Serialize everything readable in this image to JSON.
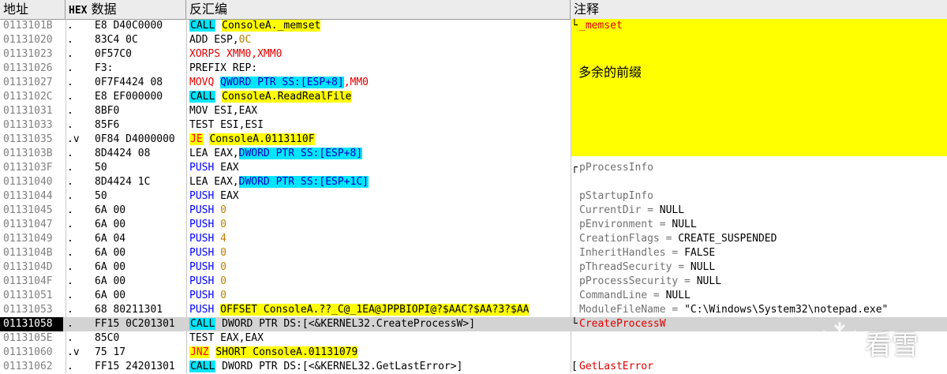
{
  "headers": {
    "address": "地址",
    "hex_prefix": "HEX",
    "hex_suffix": "数据",
    "disasm": "反汇编",
    "comment": "注释"
  },
  "note": "多余的前缀",
  "watermark": "看雪",
  "rows": [
    {
      "addr": "0113101B",
      "mark": ".",
      "hex": "E8 D40C0000",
      "dis": [
        [
          "CALL",
          "kw-call"
        ],
        [
          " ",
          ""
        ],
        [
          "ConsoleA._memset",
          "arg-y"
        ]
      ],
      "com": [
        [
          "_memset",
          "fn"
        ]
      ],
      "bk": "L"
    },
    {
      "addr": "01131020",
      "mark": ".",
      "hex": "83C4 0C",
      "dis": [
        [
          "ADD ESP,",
          ""
        ],
        [
          "0C",
          "lit"
        ]
      ],
      "com": []
    },
    {
      "addr": "01131023",
      "mark": ".",
      "hex": "0F57C0",
      "dis": [
        [
          "XORPS XMM0,XMM0",
          "kw-red"
        ]
      ],
      "com": []
    },
    {
      "addr": "01131026",
      "mark": ".",
      "hex": "F3:",
      "dis": [
        [
          "PREFIX REP:",
          ""
        ]
      ],
      "com": []
    },
    {
      "addr": "01131027",
      "mark": ".",
      "hex": "0F7F4424 08",
      "dis": [
        [
          "MOVQ",
          "kw-red"
        ],
        [
          " ",
          ""
        ],
        [
          "QWORD PTR SS:[ESP+8]",
          "arg-mem"
        ],
        [
          ",MM0",
          "kw-red"
        ]
      ],
      "com": []
    },
    {
      "addr": "0113102C",
      "mark": ".",
      "hex": "E8 EF000000",
      "dis": [
        [
          "CALL",
          "kw-call"
        ],
        [
          " ",
          ""
        ],
        [
          "ConsoleA.ReadRealFile",
          "arg-y"
        ]
      ],
      "com": []
    },
    {
      "addr": "01131031",
      "mark": ".",
      "hex": "8BF0",
      "dis": [
        [
          "MOV ESI,EAX",
          ""
        ]
      ],
      "com": []
    },
    {
      "addr": "01131033",
      "mark": ".",
      "hex": "85F6",
      "dis": [
        [
          "TEST ESI,ESI",
          ""
        ]
      ],
      "com": []
    },
    {
      "addr": "01131035",
      "mark": ".v",
      "hex": "0F84 D4000000",
      "dis": [
        [
          "JE",
          "kw-jcc"
        ],
        [
          " ",
          ""
        ],
        [
          "ConsoleA.0113110F",
          "arg-y"
        ]
      ],
      "com": []
    },
    {
      "addr": "0113103B",
      "mark": ".",
      "hex": "8D4424 08",
      "dis": [
        [
          "LEA EAX,",
          ""
        ],
        [
          "DWORD PTR SS:[ESP+8]",
          "arg-mem"
        ]
      ],
      "com": []
    },
    {
      "addr": "0113103F",
      "mark": ".",
      "hex": "50",
      "dis": [
        [
          "PUSH",
          "kw-push"
        ],
        [
          " EAX",
          ""
        ]
      ],
      "com": [
        [
          "pProcessInfo",
          "gray"
        ]
      ],
      "bk": "r"
    },
    {
      "addr": "01131040",
      "mark": ".",
      "hex": "8D4424 1C",
      "dis": [
        [
          "LEA EAX,",
          ""
        ],
        [
          "DWORD PTR SS:[ESP+1C]",
          "arg-mem"
        ]
      ],
      "com": []
    },
    {
      "addr": "01131044",
      "mark": ".",
      "hex": "50",
      "dis": [
        [
          "PUSH",
          "kw-push"
        ],
        [
          " EAX",
          ""
        ]
      ],
      "com": [
        [
          "pStartupInfo",
          "gray"
        ]
      ]
    },
    {
      "addr": "01131045",
      "mark": ".",
      "hex": "6A 00",
      "dis": [
        [
          "PUSH",
          "kw-push"
        ],
        [
          " ",
          ""
        ],
        [
          "0",
          "lit"
        ]
      ],
      "com": [
        [
          "CurrentDir = ",
          "gray"
        ],
        [
          "NULL",
          ""
        ]
      ]
    },
    {
      "addr": "01131047",
      "mark": ".",
      "hex": "6A 00",
      "dis": [
        [
          "PUSH",
          "kw-push"
        ],
        [
          " ",
          ""
        ],
        [
          "0",
          "lit"
        ]
      ],
      "com": [
        [
          "pEnvironment = ",
          "gray"
        ],
        [
          "NULL",
          ""
        ]
      ]
    },
    {
      "addr": "01131049",
      "mark": ".",
      "hex": "6A 04",
      "dis": [
        [
          "PUSH",
          "kw-push"
        ],
        [
          " ",
          ""
        ],
        [
          "4",
          "lit"
        ]
      ],
      "com": [
        [
          "CreationFlags = ",
          "gray"
        ],
        [
          "CREATE_SUSPENDED",
          ""
        ]
      ]
    },
    {
      "addr": "0113104B",
      "mark": ".",
      "hex": "6A 00",
      "dis": [
        [
          "PUSH",
          "kw-push"
        ],
        [
          " ",
          ""
        ],
        [
          "0",
          "lit"
        ]
      ],
      "com": [
        [
          "InheritHandles = ",
          "gray"
        ],
        [
          "FALSE",
          ""
        ]
      ]
    },
    {
      "addr": "0113104D",
      "mark": ".",
      "hex": "6A 00",
      "dis": [
        [
          "PUSH",
          "kw-push"
        ],
        [
          " ",
          ""
        ],
        [
          "0",
          "lit"
        ]
      ],
      "com": [
        [
          "pThreadSecurity = ",
          "gray"
        ],
        [
          "NULL",
          ""
        ]
      ]
    },
    {
      "addr": "0113104F",
      "mark": ".",
      "hex": "6A 00",
      "dis": [
        [
          "PUSH",
          "kw-push"
        ],
        [
          " ",
          ""
        ],
        [
          "0",
          "lit"
        ]
      ],
      "com": [
        [
          "pProcessSecurity = ",
          "gray"
        ],
        [
          "NULL",
          ""
        ]
      ]
    },
    {
      "addr": "01131051",
      "mark": ".",
      "hex": "6A 00",
      "dis": [
        [
          "PUSH",
          "kw-push"
        ],
        [
          " ",
          ""
        ],
        [
          "0",
          "lit"
        ]
      ],
      "com": [
        [
          "CommandLine = ",
          "gray"
        ],
        [
          "NULL",
          ""
        ]
      ]
    },
    {
      "addr": "01131053",
      "mark": ".",
      "hex": "68 80211301",
      "dis": [
        [
          "PUSH",
          "kw-push"
        ],
        [
          " ",
          ""
        ],
        [
          "OFFSET ConsoleA.??_C@_1EA@JPPBIOPI@?$AAC?$AA?3?$AA",
          "arg-y"
        ]
      ],
      "com": [
        [
          "ModuleFileName = ",
          "gray"
        ],
        [
          "\"C:\\Windows\\System32\\notepad.exe\"",
          ""
        ]
      ]
    },
    {
      "addr": "01131058",
      "mark": ".",
      "hex": "FF15 0C201301",
      "dis": [
        [
          "CALL",
          "kw-call"
        ],
        [
          " DWORD PTR DS:[<&KERNEL32.CreateProcessW>]",
          ""
        ]
      ],
      "com": [
        [
          "CreateProcessW",
          "fn"
        ]
      ],
      "sel": true,
      "bk": "L"
    },
    {
      "addr": "0113105E",
      "mark": ".",
      "hex": "85C0",
      "dis": [
        [
          "TEST EAX,EAX",
          ""
        ]
      ],
      "com": []
    },
    {
      "addr": "01131060",
      "mark": ".v",
      "hex": "75 17",
      "dis": [
        [
          "JNZ",
          "kw-jcc"
        ],
        [
          " ",
          ""
        ],
        [
          "SHORT ConsoleA.01131079",
          "arg-y"
        ]
      ],
      "com": []
    },
    {
      "addr": "01131062",
      "mark": ".",
      "hex": "FF15 24201301",
      "dis": [
        [
          "CALL",
          "kw-call"
        ],
        [
          " DWORD PTR DS:[<&KERNEL32.GetLastError>]",
          ""
        ]
      ],
      "com": [
        [
          "GetLastError",
          "fn"
        ]
      ],
      "bk": "["
    }
  ]
}
